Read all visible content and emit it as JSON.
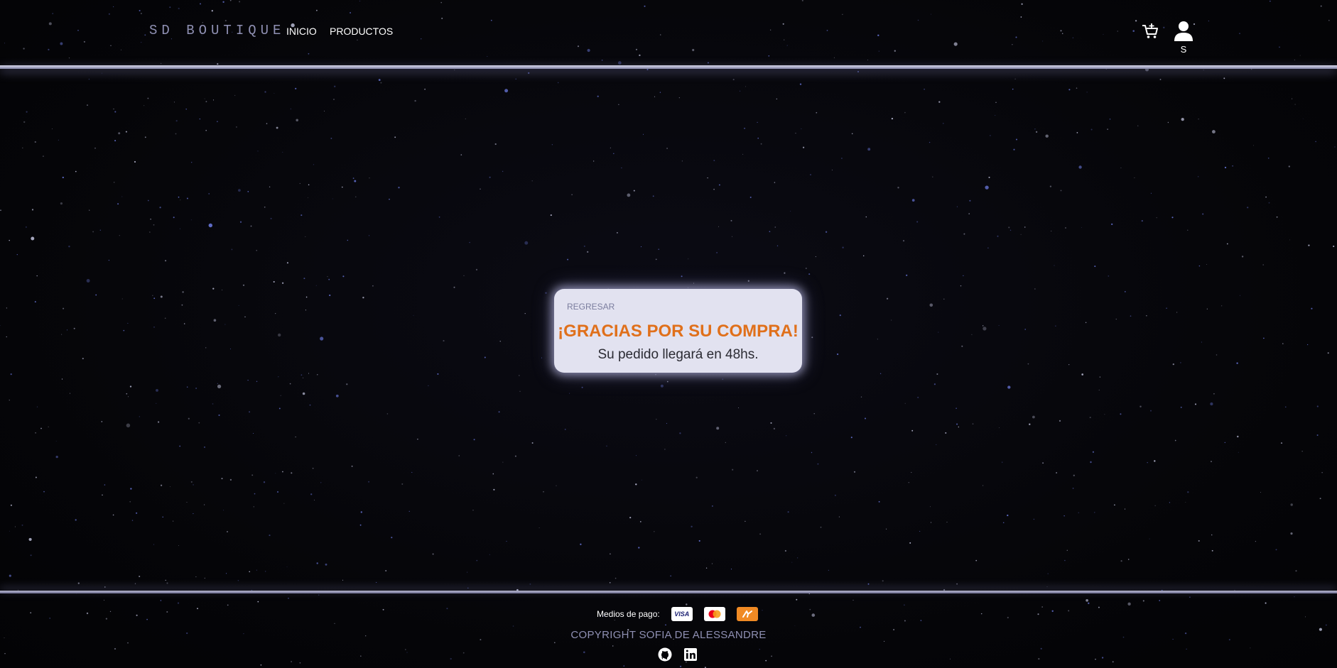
{
  "header": {
    "brand": "SD BOUTIQUE",
    "nav": [
      {
        "label": "INICIO"
      },
      {
        "label": "PRODUCTOS"
      }
    ],
    "cart_icon": "cart-plus-icon",
    "user_icon": "user-icon",
    "user_initial": "S"
  },
  "card": {
    "back_label": "REGRESAR",
    "title": "¡GRACIAS POR SU COMPRA!",
    "subtitle": "Su pedido llegará en 48hs."
  },
  "footer": {
    "payments_label": "Medios de pago:",
    "payment_methods": [
      {
        "icon": "visa-icon",
        "label": "VISA"
      },
      {
        "icon": "mastercard-icon"
      },
      {
        "icon": "mercadopago-icon"
      }
    ],
    "copyright": "COPYRIGHT SOFIA DE ALESSANDRE",
    "socials": [
      {
        "icon": "github-icon"
      },
      {
        "icon": "linkedin-icon"
      }
    ]
  },
  "colors": {
    "background": "#05050a",
    "brand": "#8f90b3",
    "accent": "#e0701b",
    "card": "#e2e2f0"
  }
}
